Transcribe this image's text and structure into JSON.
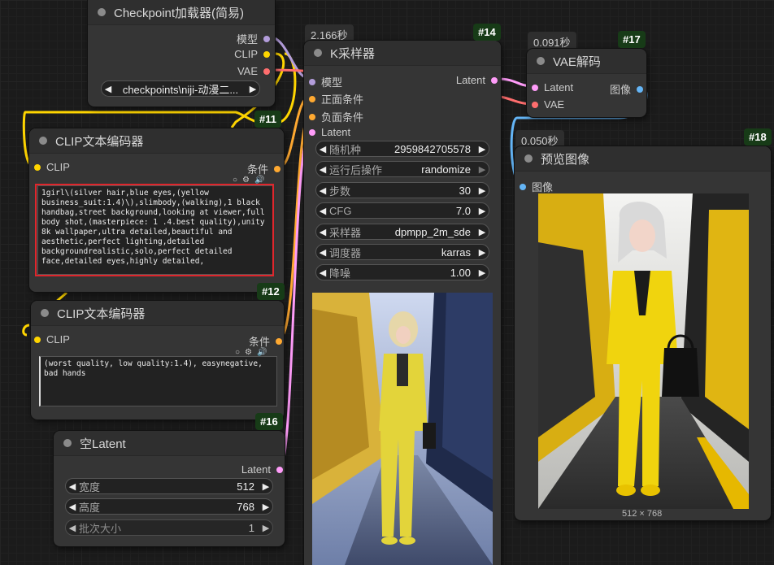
{
  "colors": {
    "model": "#b39ddb",
    "clip": "#ffd500",
    "vae": "#ff6e6e",
    "conditioning": "#ffa931",
    "latent": "#ff9cf9",
    "image": "#64b5f6",
    "node_id_badge": "#173b17",
    "highlight_box": "#e0262c"
  },
  "checkpoint": {
    "title": "Checkpoint加载器(简易)",
    "id": "#11",
    "outputs": [
      "模型",
      "CLIP",
      "VAE"
    ],
    "ckpt_name": "checkpoints\\niji-动漫二..."
  },
  "clip_pos": {
    "title": "CLIP文本编码器",
    "id": "#12",
    "input": "CLIP",
    "output": "条件",
    "text": "1girl\\(silver hair,blue eyes,(yellow business_suit:1.4)\\),slimbody,(walking),1 black handbag,street background,looking at viewer,full body shot,(masterpiece: 1 .4.best quality),unity 8k wallpaper,ultra detailed,beautiful and aesthetic,perfect lighting,detailed backgroundrealistic,solo,perfect detailed face,detailed eyes,highly detailed,"
  },
  "clip_neg": {
    "title": "CLIP文本编码器",
    "id": "#16",
    "input": "CLIP",
    "output": "条件",
    "text": "(worst quality, low quality:1.4), easynegative, bad hands"
  },
  "empty_latent": {
    "title": "空Latent",
    "output": "Latent",
    "widgets": [
      {
        "label": "宽度",
        "value": "512"
      },
      {
        "label": "高度",
        "value": "768"
      },
      {
        "label": "批次大小",
        "value": "1"
      }
    ]
  },
  "ksampler": {
    "title": "K采样器",
    "id": "#14",
    "time": "2.166秒",
    "inputs": [
      "模型",
      "正面条件",
      "负面条件",
      "Latent"
    ],
    "output": "Latent",
    "widgets": [
      {
        "label": "随机种",
        "value": "2959842705578"
      },
      {
        "label": "运行后操作",
        "value": "randomize"
      },
      {
        "label": "步数",
        "value": "30"
      },
      {
        "label": "CFG",
        "value": "7.0"
      },
      {
        "label": "采样器",
        "value": "dpmpp_2m_sde"
      },
      {
        "label": "调度器",
        "value": "karras"
      },
      {
        "label": "降噪",
        "value": "1.00"
      }
    ]
  },
  "vae_decode": {
    "title": "VAE解码",
    "id": "#17",
    "time": "0.091秒",
    "inputs": [
      "Latent",
      "VAE"
    ],
    "output": "图像"
  },
  "preview": {
    "title": "预览图像",
    "id": "#18",
    "time": "0.050秒",
    "input": "图像",
    "image_size": "512 × 768"
  },
  "icons": {
    "node_dot": "circle-dot",
    "widget_left": "triangle-left",
    "widget_right": "triangle-right",
    "text_toolbar": [
      "circle-icon",
      "gear-icon",
      "speaker-icon"
    ]
  }
}
